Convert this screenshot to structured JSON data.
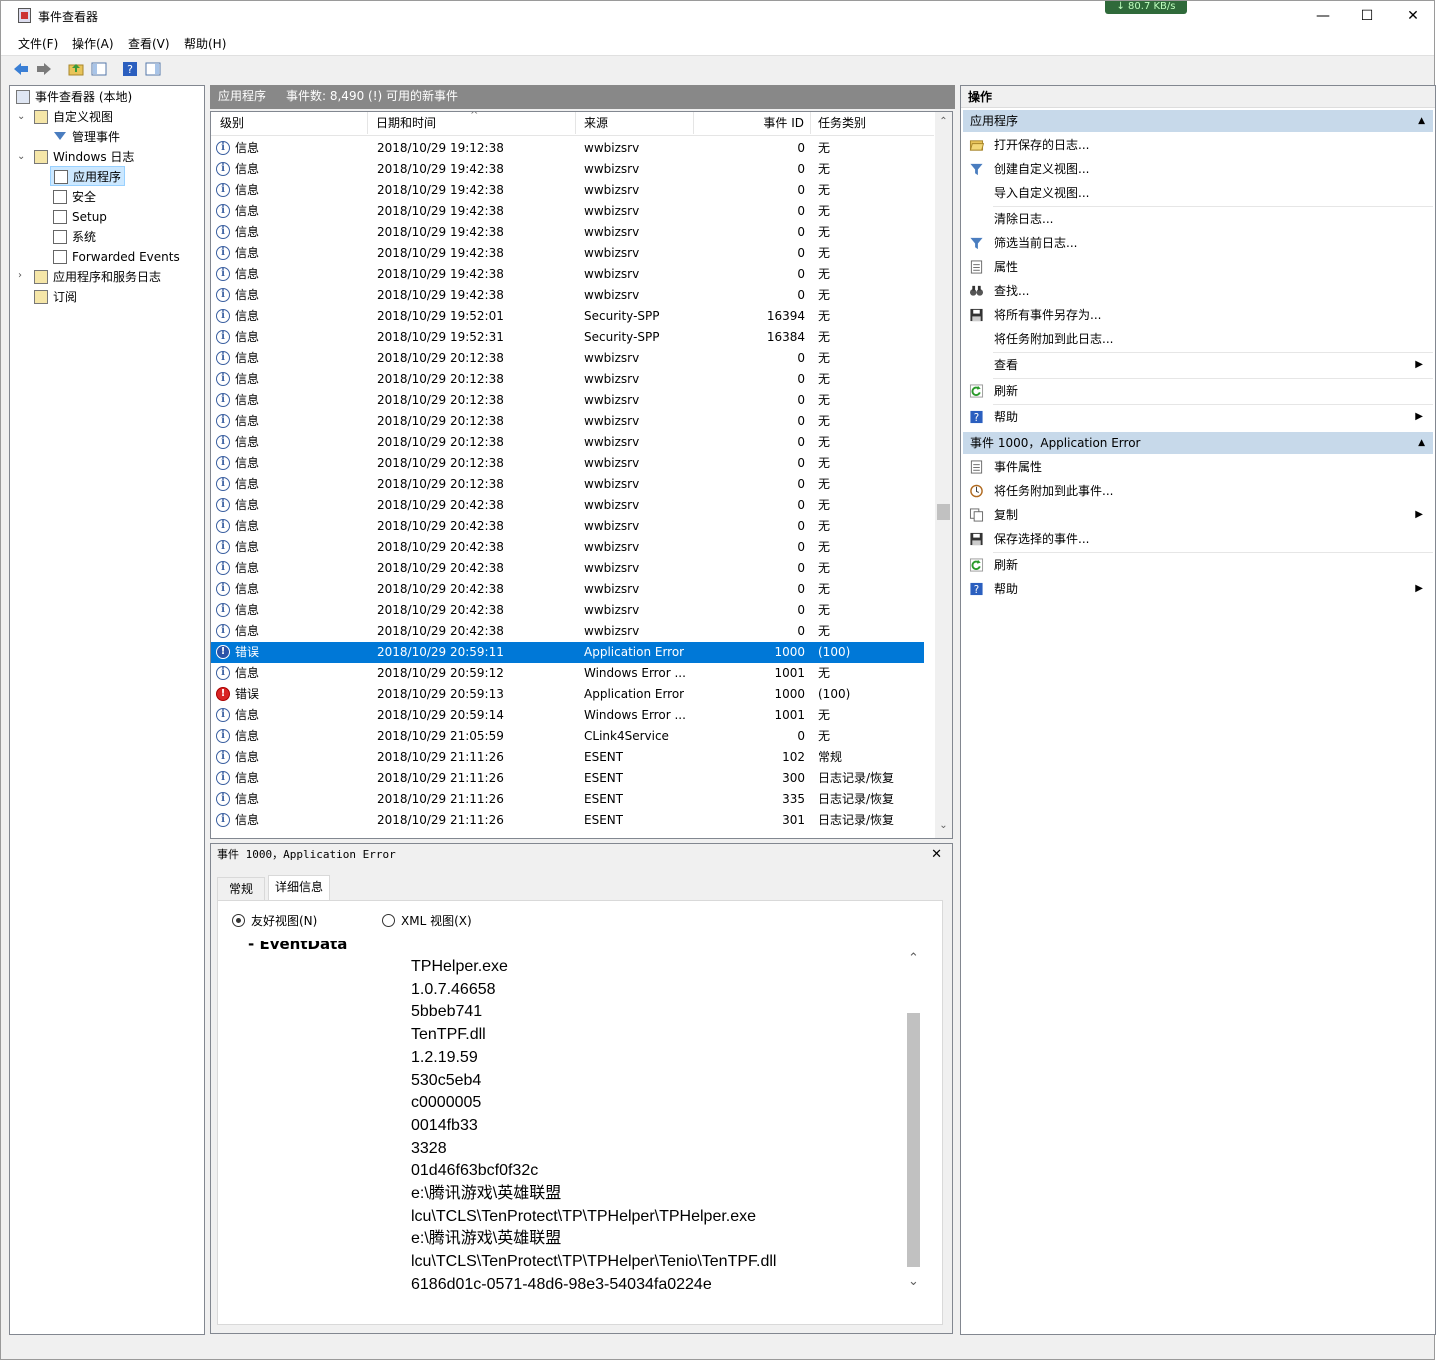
{
  "window": {
    "title": "事件查看器",
    "net_speed": "↓ 80.7 KB/s",
    "minimize": "—",
    "maximize": "☐",
    "close": "✕"
  },
  "menu": [
    "文件(F)",
    "操作(A)",
    "查看(V)",
    "帮助(H)"
  ],
  "tree": {
    "root": "事件查看器 (本地)",
    "custom_views": "自定义视图",
    "admin_events": "管理事件",
    "windows_logs": "Windows 日志",
    "application": "应用程序",
    "security": "安全",
    "setup": "Setup",
    "system": "系统",
    "forwarded": "Forwarded Events",
    "app_service_logs": "应用程序和服务日志",
    "subscriptions": "订阅"
  },
  "center_header": {
    "name": "应用程序",
    "count": "事件数: 8,490 (!) 可用的新事件"
  },
  "columns": [
    "级别",
    "日期和时间",
    "来源",
    "事件 ID",
    "任务类别"
  ],
  "events": [
    {
      "level": "信息",
      "type": "info",
      "date": "2018/10/29 19:12:38",
      "source": "wwbizsrv",
      "id": "0",
      "task": "无"
    },
    {
      "level": "信息",
      "type": "info",
      "date": "2018/10/29 19:42:38",
      "source": "wwbizsrv",
      "id": "0",
      "task": "无"
    },
    {
      "level": "信息",
      "type": "info",
      "date": "2018/10/29 19:42:38",
      "source": "wwbizsrv",
      "id": "0",
      "task": "无"
    },
    {
      "level": "信息",
      "type": "info",
      "date": "2018/10/29 19:42:38",
      "source": "wwbizsrv",
      "id": "0",
      "task": "无"
    },
    {
      "level": "信息",
      "type": "info",
      "date": "2018/10/29 19:42:38",
      "source": "wwbizsrv",
      "id": "0",
      "task": "无"
    },
    {
      "level": "信息",
      "type": "info",
      "date": "2018/10/29 19:42:38",
      "source": "wwbizsrv",
      "id": "0",
      "task": "无"
    },
    {
      "level": "信息",
      "type": "info",
      "date": "2018/10/29 19:42:38",
      "source": "wwbizsrv",
      "id": "0",
      "task": "无"
    },
    {
      "level": "信息",
      "type": "info",
      "date": "2018/10/29 19:42:38",
      "source": "wwbizsrv",
      "id": "0",
      "task": "无"
    },
    {
      "level": "信息",
      "type": "info",
      "date": "2018/10/29 19:52:01",
      "source": "Security-SPP",
      "id": "16394",
      "task": "无"
    },
    {
      "level": "信息",
      "type": "info",
      "date": "2018/10/29 19:52:31",
      "source": "Security-SPP",
      "id": "16384",
      "task": "无"
    },
    {
      "level": "信息",
      "type": "info",
      "date": "2018/10/29 20:12:38",
      "source": "wwbizsrv",
      "id": "0",
      "task": "无"
    },
    {
      "level": "信息",
      "type": "info",
      "date": "2018/10/29 20:12:38",
      "source": "wwbizsrv",
      "id": "0",
      "task": "无"
    },
    {
      "level": "信息",
      "type": "info",
      "date": "2018/10/29 20:12:38",
      "source": "wwbizsrv",
      "id": "0",
      "task": "无"
    },
    {
      "level": "信息",
      "type": "info",
      "date": "2018/10/29 20:12:38",
      "source": "wwbizsrv",
      "id": "0",
      "task": "无"
    },
    {
      "level": "信息",
      "type": "info",
      "date": "2018/10/29 20:12:38",
      "source": "wwbizsrv",
      "id": "0",
      "task": "无"
    },
    {
      "level": "信息",
      "type": "info",
      "date": "2018/10/29 20:12:38",
      "source": "wwbizsrv",
      "id": "0",
      "task": "无"
    },
    {
      "level": "信息",
      "type": "info",
      "date": "2018/10/29 20:12:38",
      "source": "wwbizsrv",
      "id": "0",
      "task": "无"
    },
    {
      "level": "信息",
      "type": "info",
      "date": "2018/10/29 20:42:38",
      "source": "wwbizsrv",
      "id": "0",
      "task": "无"
    },
    {
      "level": "信息",
      "type": "info",
      "date": "2018/10/29 20:42:38",
      "source": "wwbizsrv",
      "id": "0",
      "task": "无"
    },
    {
      "level": "信息",
      "type": "info",
      "date": "2018/10/29 20:42:38",
      "source": "wwbizsrv",
      "id": "0",
      "task": "无"
    },
    {
      "level": "信息",
      "type": "info",
      "date": "2018/10/29 20:42:38",
      "source": "wwbizsrv",
      "id": "0",
      "task": "无"
    },
    {
      "level": "信息",
      "type": "info",
      "date": "2018/10/29 20:42:38",
      "source": "wwbizsrv",
      "id": "0",
      "task": "无"
    },
    {
      "level": "信息",
      "type": "info",
      "date": "2018/10/29 20:42:38",
      "source": "wwbizsrv",
      "id": "0",
      "task": "无"
    },
    {
      "level": "信息",
      "type": "info",
      "date": "2018/10/29 20:42:38",
      "source": "wwbizsrv",
      "id": "0",
      "task": "无"
    },
    {
      "level": "错误",
      "type": "error",
      "selected": true,
      "date": "2018/10/29 20:59:11",
      "source": "Application Error",
      "id": "1000",
      "task": "(100)"
    },
    {
      "level": "信息",
      "type": "info",
      "date": "2018/10/29 20:59:12",
      "source": "Windows Error ...",
      "id": "1001",
      "task": "无"
    },
    {
      "level": "错误",
      "type": "error",
      "date": "2018/10/29 20:59:13",
      "source": "Application Error",
      "id": "1000",
      "task": "(100)"
    },
    {
      "level": "信息",
      "type": "info",
      "date": "2018/10/29 20:59:14",
      "source": "Windows Error ...",
      "id": "1001",
      "task": "无"
    },
    {
      "level": "信息",
      "type": "info",
      "date": "2018/10/29 21:05:59",
      "source": "CLink4Service",
      "id": "0",
      "task": "无"
    },
    {
      "level": "信息",
      "type": "info",
      "date": "2018/10/29 21:11:26",
      "source": "ESENT",
      "id": "102",
      "task": "常规"
    },
    {
      "level": "信息",
      "type": "info",
      "date": "2018/10/29 21:11:26",
      "source": "ESENT",
      "id": "300",
      "task": "日志记录/恢复"
    },
    {
      "level": "信息",
      "type": "info",
      "date": "2018/10/29 21:11:26",
      "source": "ESENT",
      "id": "335",
      "task": "日志记录/恢复"
    },
    {
      "level": "信息",
      "type": "info",
      "date": "2018/10/29 21:11:26",
      "source": "ESENT",
      "id": "301",
      "task": "日志记录/恢复"
    }
  ],
  "detail": {
    "title": "事件 1000，Application Error",
    "close": "✕",
    "tabs": [
      "常规",
      "详细信息"
    ],
    "friendly_view": "友好视图(N)",
    "xml_view": "XML 视图(X)",
    "section": "-  EventData",
    "values": [
      "TPHelper.exe",
      "1.0.7.46658",
      "5bbeb741",
      "TenTPF.dll",
      "1.2.19.59",
      "530c5eb4",
      "c0000005",
      "0014fb33",
      "3328",
      "01d46f63bcf0f32c",
      "e:\\腾讯游戏\\英雄联盟",
      "lcu\\TCLS\\TenProtect\\TP\\TPHelper\\TPHelper.exe",
      "e:\\腾讯游戏\\英雄联盟",
      "lcu\\TCLS\\TenProtect\\TP\\TPHelper\\Tenio\\TenTPF.dll",
      "6186d01c-0571-48d6-98e3-54034fa0224e"
    ]
  },
  "actions": {
    "header": "操作",
    "section1": "应用程序",
    "items1": [
      {
        "label": "打开保存的日志...",
        "icon": "folder-open-icon"
      },
      {
        "label": "创建自定义视图...",
        "icon": "filter-icon"
      },
      {
        "label": "导入自定义视图...",
        "icon": ""
      },
      {
        "label": "清除日志...",
        "icon": ""
      },
      {
        "label": "筛选当前日志...",
        "icon": "filter-icon"
      },
      {
        "label": "属性",
        "icon": "properties-icon"
      },
      {
        "label": "查找...",
        "icon": "binoculars-icon"
      },
      {
        "label": "将所有事件另存为...",
        "icon": "save-icon"
      },
      {
        "label": "将任务附加到此日志...",
        "icon": ""
      },
      {
        "label": "查看",
        "icon": "",
        "submenu": true
      },
      {
        "label": "刷新",
        "icon": "refresh-icon"
      },
      {
        "label": "帮助",
        "icon": "help-icon",
        "submenu": true
      }
    ],
    "section2": "事件 1000，Application Error",
    "items2": [
      {
        "label": "事件属性",
        "icon": "properties-icon"
      },
      {
        "label": "将任务附加到此事件...",
        "icon": "task-icon"
      },
      {
        "label": "复制",
        "icon": "copy-icon",
        "submenu": true
      },
      {
        "label": "保存选择的事件...",
        "icon": "save-icon"
      },
      {
        "label": "刷新",
        "icon": "refresh-icon"
      },
      {
        "label": "帮助",
        "icon": "help-icon",
        "submenu": true
      }
    ]
  }
}
